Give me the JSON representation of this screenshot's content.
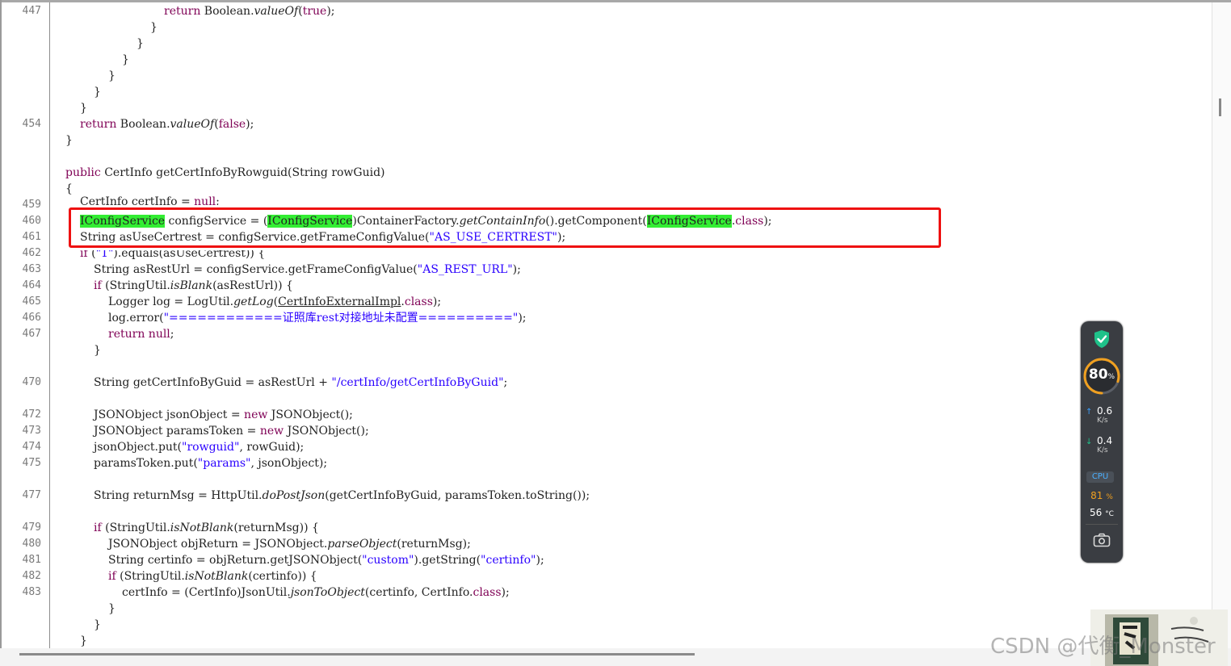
{
  "editor": {
    "line_numbers": [
      "447",
      "454",
      "459",
      "460",
      "461",
      "462",
      "463",
      "464",
      "465",
      "466",
      "467",
      "470",
      "472",
      "473",
      "474",
      "475",
      "477",
      "479",
      "480",
      "481",
      "482",
      "483"
    ],
    "code": {
      "l447": {
        "kw": "return",
        "a": " Boolean.",
        "it": "valueOf",
        "b": "(",
        "kw2": "true",
        "c": ");"
      },
      "l448": "}",
      "l449": "}",
      "l450": "}",
      "l451": "}",
      "l452": "}",
      "l453": "}",
      "l454": {
        "kw": "return",
        "a": " Boolean.",
        "it": "valueOf",
        "b": "(",
        "kw2": "false",
        "c": ");"
      },
      "l455": "}",
      "l457": {
        "kw": "public",
        "a": " CertInfo getCertInfoByRowguid(String rowGuid)"
      },
      "l458": "{",
      "l459": {
        "a": "CertInfo certInfo = ",
        "kw": "null",
        ";": ";"
      },
      "l460": {
        "hl1": "IConfigService",
        "a": " configService = (",
        "hl2": "IConfigService",
        "b": ")ContainerFactory.",
        "it": "getContainInfo",
        "c": "().getComponent(",
        "hl3": "IConfigService",
        "d": ".",
        "kw": "class",
        "e": ");"
      },
      "l461": {
        "a": "String asUseCertrest = configService.getFrameConfigValue(",
        "str": "\"AS_USE_CERTREST\"",
        "b": ");"
      },
      "l462": {
        "kw": "if",
        "a": " (",
        "str": "\"1\"",
        "b": ").equals(asUseCertrest)) {"
      },
      "l463": {
        "a": "String asRestUrl = configService.getFrameConfigValue(",
        "str": "\"AS_REST_URL\"",
        "b": ");"
      },
      "l464": {
        "kw": "if",
        "a": " (StringUtil.",
        "it": "isBlank",
        "b": "(asRestUrl)) {"
      },
      "l465": {
        "a": "Logger log = LogUtil.",
        "it": "getLog",
        "b": "(",
        "ul": "CertInfoExternalImpl",
        "c": ".",
        "kw": "class",
        "d": ");"
      },
      "l466": {
        "a": "log.error(",
        "str": "\"============证照库rest对接地址未配置==========\"",
        "b": ");"
      },
      "l467": {
        "kw": "return",
        "a": " ",
        "kw2": "null",
        "b": ";"
      },
      "l468": "}",
      "l470": {
        "a": "String getCertInfoByGuid = asRestUrl + ",
        "str": "\"/certInfo/getCertInfoByGuid\"",
        "b": ";"
      },
      "l472": {
        "a": "JSONObject jsonObject = ",
        "kw": "new",
        "b": " JSONObject();"
      },
      "l473": {
        "a": "JSONObject paramsToken = ",
        "kw": "new",
        "b": " JSONObject();"
      },
      "l474": {
        "a": "jsonObject.put(",
        "str": "\"rowguid\"",
        "b": ", rowGuid);"
      },
      "l475": {
        "a": "paramsToken.put(",
        "str": "\"params\"",
        "b": ", jsonObject);"
      },
      "l477": {
        "a": "String returnMsg = HttpUtil.",
        "it": "doPostJson",
        "b": "(getCertInfoByGuid, paramsToken.toString());"
      },
      "l479": {
        "kw": "if",
        "a": " (StringUtil.",
        "it": "isNotBlank",
        "b": "(returnMsg)) {"
      },
      "l480": {
        "a": "JSONObject objReturn = JSONObject.",
        "it": "parseObject",
        "b": "(returnMsg);"
      },
      "l481": {
        "a": "String certinfo = objReturn.getJSONObject(",
        "str": "\"custom\"",
        "b": ").getString(",
        "str2": "\"certinfo\"",
        "c": ");"
      },
      "l482": {
        "kw": "if",
        "a": " (StringUtil.",
        "it": "isNotBlank",
        "b": "(certinfo)) {"
      },
      "l483": {
        "a": "certInfo = (CertInfo)JsonUtil.",
        "it": "jsonToObject",
        "b": "(certinfo, CertInfo.",
        "kw": "class",
        "c": ");"
      },
      "l484": "}",
      "l485": "}",
      "l486": "}"
    }
  },
  "monitor": {
    "gauge_value": "80",
    "gauge_unit": "%",
    "upload_value": "0.6",
    "upload_unit": "K/s",
    "download_value": "0.4",
    "download_unit": "K/s",
    "cpu_label": "CPU",
    "cpu_usage": "81",
    "cpu_usage_unit": "%",
    "cpu_temp": "56",
    "cpu_temp_unit": "°C",
    "colors": {
      "shield": "#1fc28a",
      "gauge": "#f0a020",
      "cpu_label": "#4ab0ff"
    }
  },
  "watermark": {
    "text": "CSDN @代衡_Monster"
  }
}
